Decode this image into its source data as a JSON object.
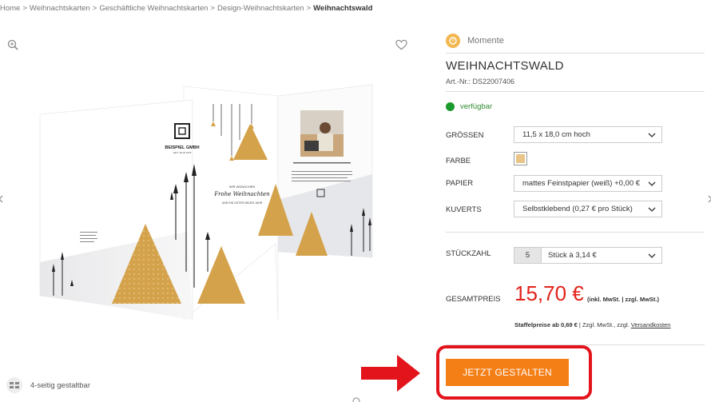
{
  "breadcrumb": {
    "items": [
      "Home",
      "Weihnachtskarten",
      "Geschäftliche Weihnachtskarten",
      "Design-Weihnachtskarten"
    ],
    "separator": ">",
    "current": "Weihnachtswald"
  },
  "gallery": {
    "feature_label": "4-seitig gestaltbar",
    "card": {
      "company_name": "BEISPIEL GMBH",
      "company_sub": "SEIT JAHR 1969",
      "greeting_top": "WIR WÜNSCHEN",
      "greeting_main": "Frohe Weihnachten",
      "greeting_bottom": "UND EIN GUTES NEUES JAHR"
    }
  },
  "product": {
    "brand": "Momente",
    "title": "WEIHNACHTSWALD",
    "article_number": "Art.-Nr.: DS22007406",
    "availability": "verfügbar",
    "options": {
      "size_label": "GRÖSSEN",
      "size_value": "11,5 x 18,0 cm hoch",
      "color_label": "FARBE",
      "color_swatch": "#e9c486",
      "paper_label": "PAPIER",
      "paper_value": "mattes Feinstpapier (weiß) +0,00 €",
      "envelope_label": "KUVERTS",
      "envelope_value": "Selbstklebend (0,27 € pro Stück)"
    },
    "quantity": {
      "label": "STÜCKZAHL",
      "value": "5",
      "unit_price": "Stück à 3,14 €"
    },
    "total": {
      "label": "GESAMTPREIS",
      "price": "15,70 €",
      "note": "(inkl. MwSt. | zzgl. MwSt.)"
    },
    "staffel": {
      "text": "Staffelpreise ab 0,69 €",
      "sep": "|",
      "tax": "Zzgl. MwSt., zzgl.",
      "shipping_link": "Versandkosten"
    },
    "cta_label": "JETZT GESTALTEN"
  },
  "colors": {
    "accent_orange": "#f57f17",
    "price_red": "#e2231a",
    "highlight_red": "#e3141c",
    "available_green": "#1a9a2c",
    "gold": "#d4a24a"
  }
}
